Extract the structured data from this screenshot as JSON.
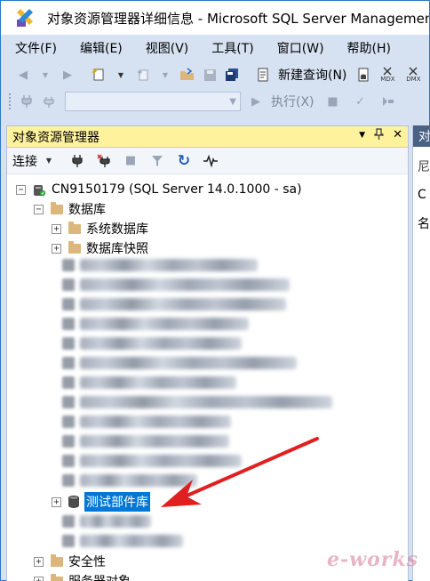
{
  "window": {
    "title": "对象资源管理器详细信息 - Microsoft SQL Server Managemen"
  },
  "menu": {
    "items": [
      "文件(F)",
      "编辑(E)",
      "视图(V)",
      "工具(T)",
      "窗口(W)",
      "帮助(H)"
    ]
  },
  "toolbar": {
    "new_query_label": "新建查询(N)",
    "mdx_label": "MDX",
    "dmx_label": "DMX",
    "execute_label": "执行(X)"
  },
  "object_explorer": {
    "title": "对象资源管理器",
    "connect_label": "连接",
    "server_node": "CN9150179 (SQL Server 14.0.1000 - sa)",
    "databases_folder": "数据库",
    "system_databases": "系统数据库",
    "database_snapshots": "数据库快照",
    "highlighted_database": "测试部件库",
    "security_folder": "安全性",
    "server_objects_folder": "服务器对象"
  },
  "right_panel": {
    "title_fragment": "对",
    "line1": "尼",
    "line2": "C",
    "line3": "名"
  },
  "watermark": "e-works",
  "colors": {
    "panel_title_bg": "#fff29d",
    "selection": "#0078d7",
    "arrow": "#e02020",
    "folder": "#dcb67a"
  }
}
